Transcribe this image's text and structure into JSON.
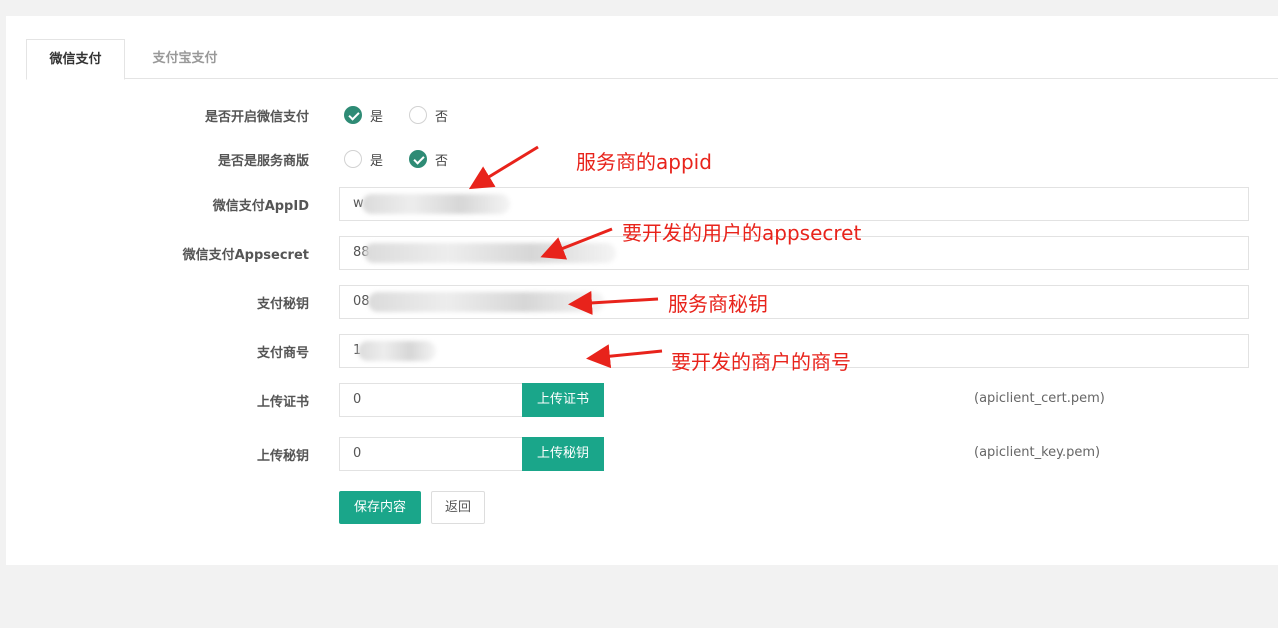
{
  "tabs": [
    {
      "label": "微信支付",
      "active": true
    },
    {
      "label": "支付宝支付",
      "active": false
    }
  ],
  "form": {
    "enable_wechat": {
      "label": "是否开启微信支付",
      "options": [
        "是",
        "否"
      ],
      "selected": "是"
    },
    "is_service": {
      "label": "是否是服务商版",
      "options": [
        "是",
        "否"
      ],
      "selected": "否"
    },
    "appid": {
      "label": "微信支付AppID",
      "value": "w"
    },
    "appsecret": {
      "label": "微信支付Appsecret",
      "value": "88"
    },
    "pay_key": {
      "label": "支付秘钥",
      "value": "08"
    },
    "merchant_no": {
      "label": "支付商号",
      "value": "1"
    },
    "cert": {
      "label": "上传证书",
      "value": "0",
      "button": "上传证书",
      "hint": "(apiclient_cert.pem)"
    },
    "key": {
      "label": "上传秘钥",
      "value": "0",
      "button": "上传秘钥",
      "hint": "(apiclient_key.pem)"
    }
  },
  "actions": {
    "save": "保存内容",
    "back": "返回"
  },
  "annotations": {
    "appid": "服务商的appid",
    "appsecret": "要开发的用户的appsecret",
    "pay_key": "服务商秘钥",
    "merchant_no": "要开发的商户的商号"
  },
  "colors": {
    "accent": "#1aa68a",
    "radio_checked": "#2e8b75",
    "annotation": "#e8231b"
  }
}
